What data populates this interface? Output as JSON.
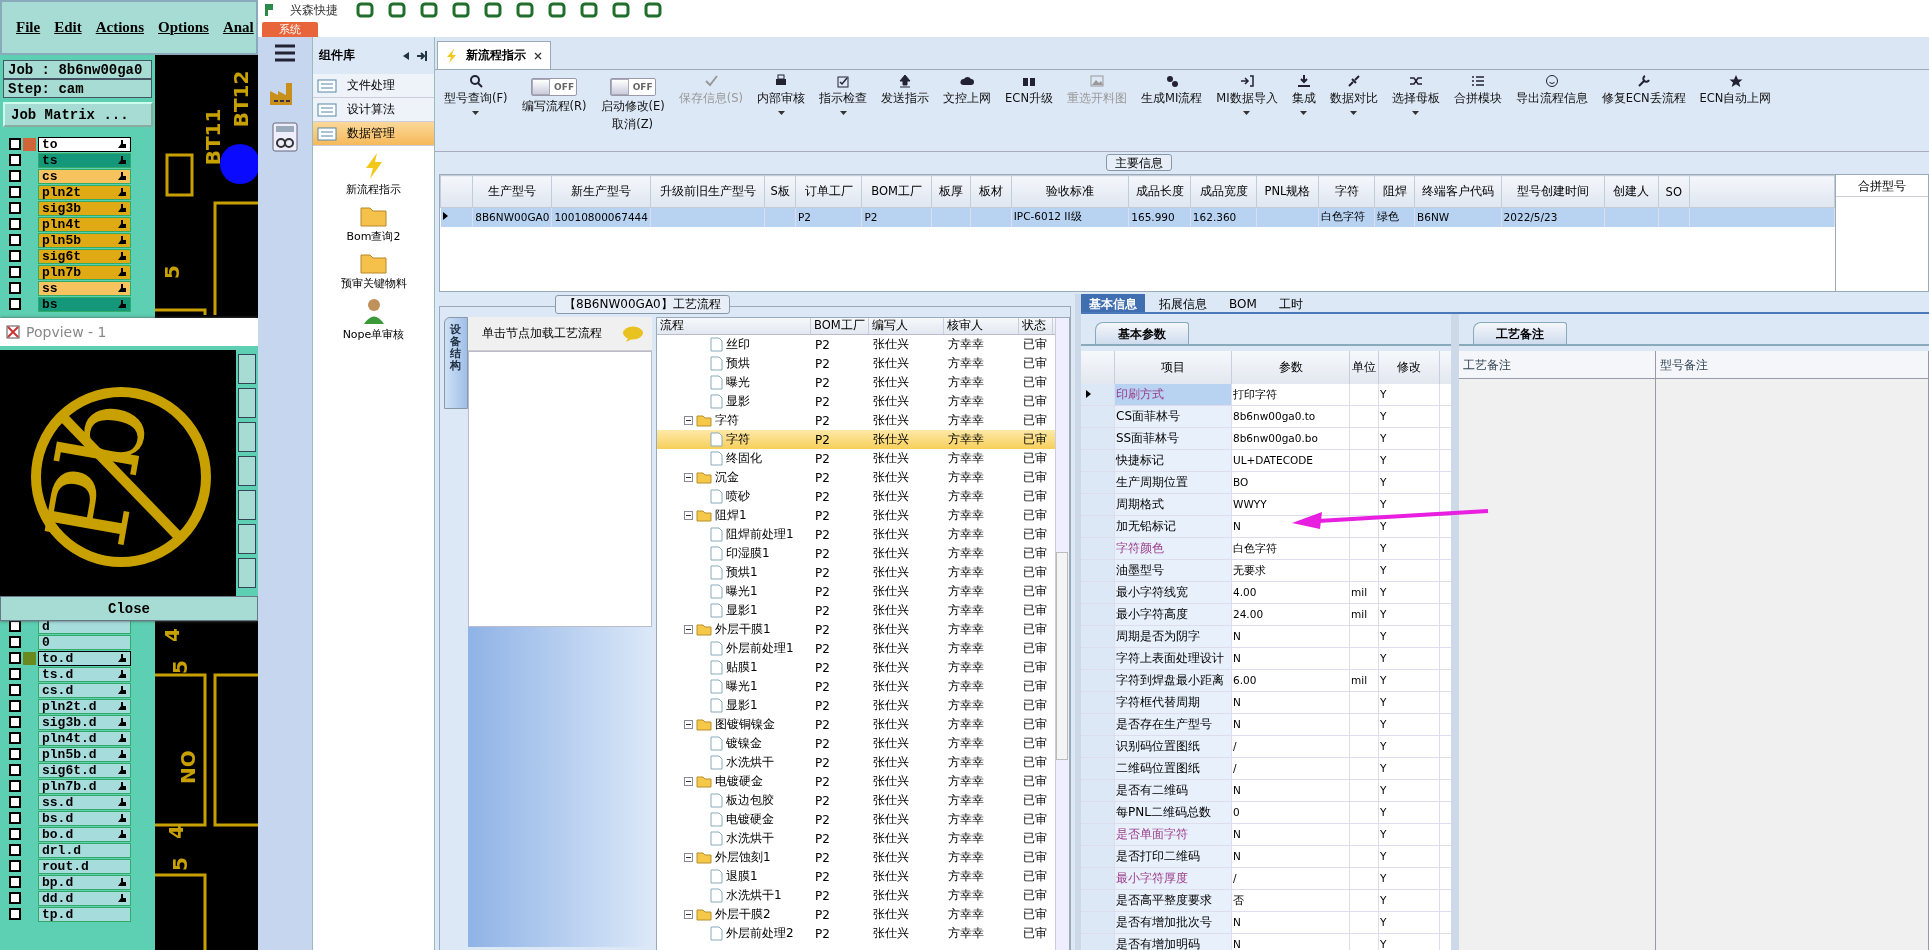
{
  "cam": {
    "menu": [
      "File",
      "Edit",
      "Actions",
      "Options",
      "Anal"
    ],
    "job": "Job : 8b6nw00ga0",
    "step": "Step: cam",
    "matrix_button": "Job Matrix ...",
    "layers_top": [
      {
        "name": "to",
        "color": "#ffffff",
        "selected": true,
        "checked": false,
        "editable": true
      },
      {
        "name": "ts",
        "color": "#15987a",
        "selected": false,
        "checked": false,
        "editable": true
      },
      {
        "name": "cs",
        "color": "#f7c35f",
        "selected": false,
        "checked": false,
        "editable": true
      },
      {
        "name": "pln2t",
        "color": "#e0aa14",
        "selected": false,
        "checked": false,
        "editable": true
      },
      {
        "name": "sig3b",
        "color": "#e0aa14",
        "selected": false,
        "checked": false,
        "editable": true
      },
      {
        "name": "pln4t",
        "color": "#e0aa14",
        "selected": false,
        "checked": false,
        "editable": true
      },
      {
        "name": "pln5b",
        "color": "#e0aa14",
        "selected": false,
        "checked": false,
        "editable": true
      },
      {
        "name": "sig6t",
        "color": "#e0aa14",
        "selected": false,
        "checked": false,
        "editable": true
      },
      {
        "name": "pln7b",
        "color": "#e0aa14",
        "selected": false,
        "checked": false,
        "editable": true
      },
      {
        "name": "ss",
        "color": "#f7c35f",
        "selected": false,
        "checked": false,
        "editable": true
      },
      {
        "name": "bs",
        "color": "#15987a",
        "selected": false,
        "checked": false,
        "editable": true
      }
    ],
    "canvas_labels": [
      "BT11",
      "BT12",
      "5",
      "4",
      "5",
      "NO",
      "4",
      "5"
    ],
    "layers_bottom": [
      {
        "name": "d",
        "color": "#a6dcdc",
        "selected": false,
        "checked": false,
        "editable": false
      },
      {
        "name": "0",
        "color": "#a6dcdc",
        "selected": false,
        "checked": false,
        "editable": false
      },
      {
        "name": "to.d",
        "color": "#a6dcdc",
        "selected": true,
        "checked": false,
        "editable": true
      },
      {
        "name": "ts.d",
        "color": "#a6dcdc",
        "selected": false,
        "checked": false,
        "editable": true
      },
      {
        "name": "cs.d",
        "color": "#a6dcdc",
        "selected": false,
        "checked": false,
        "editable": true
      },
      {
        "name": "pln2t.d",
        "color": "#a6dcdc",
        "selected": false,
        "checked": false,
        "editable": true
      },
      {
        "name": "sig3b.d",
        "color": "#a6dcdc",
        "selected": false,
        "checked": false,
        "editable": true
      },
      {
        "name": "pln4t.d",
        "color": "#a6dcdc",
        "selected": false,
        "checked": false,
        "editable": true
      },
      {
        "name": "pln5b.d",
        "color": "#a6dcdc",
        "selected": false,
        "checked": false,
        "editable": true
      },
      {
        "name": "sig6t.d",
        "color": "#a6dcdc",
        "selected": false,
        "checked": false,
        "editable": true
      },
      {
        "name": "pln7b.d",
        "color": "#a6dcdc",
        "selected": false,
        "checked": false,
        "editable": true
      },
      {
        "name": "ss.d",
        "color": "#a6dcdc",
        "selected": false,
        "checked": false,
        "editable": true
      },
      {
        "name": "bs.d",
        "color": "#a6dcdc",
        "selected": false,
        "checked": false,
        "editable": true
      },
      {
        "name": "bo.d",
        "color": "#a6dcdc",
        "selected": false,
        "checked": false,
        "editable": true
      },
      {
        "name": "drl.d",
        "color": "#a6dcdc",
        "selected": false,
        "checked": false,
        "editable": false
      },
      {
        "name": "rout.d",
        "color": "#a6dcdc",
        "selected": false,
        "checked": false,
        "editable": false
      },
      {
        "name": "bp.d",
        "color": "#a6dcdc",
        "selected": false,
        "checked": false,
        "editable": true
      },
      {
        "name": "dd.d",
        "color": "#a6dcdc",
        "selected": false,
        "checked": false,
        "editable": true
      },
      {
        "name": "tp.d",
        "color": "#a6dcdc",
        "selected": false,
        "checked": false,
        "editable": false
      }
    ]
  },
  "popview": {
    "title": "Popview - 1",
    "symbol_text": "Pb",
    "close_button": "Close"
  },
  "app": {
    "brand": "兴森快捷",
    "system_tab": "系统",
    "library": {
      "title": "组件库",
      "categories": [
        {
          "label": "文件处理",
          "selected": false
        },
        {
          "label": "设计算法",
          "selected": false
        },
        {
          "label": "数据管理",
          "selected": true
        }
      ],
      "tools": [
        {
          "label": "新流程指示"
        },
        {
          "label": "Bom查询2"
        },
        {
          "label": "预审关键物料"
        },
        {
          "label": "Nope单审核"
        }
      ]
    },
    "document_tab": {
      "label": "新流程指示"
    },
    "ribbon": [
      {
        "kind": "button",
        "label": "型号查询(F)",
        "disabled": false,
        "dropdown": true
      },
      {
        "kind": "toggle",
        "label": "编写流程(R)",
        "switch_text": "OFF",
        "on": false
      },
      {
        "kind": "toggle",
        "label": "启动修改(E)",
        "label2": "取消(Z)",
        "switch_text": "OFF",
        "on": false
      },
      {
        "kind": "button",
        "label": "保存信息(S)",
        "disabled": true,
        "dropdown": false
      },
      {
        "kind": "button",
        "label": "内部审核",
        "disabled": false,
        "dropdown": true
      },
      {
        "kind": "button",
        "label": "指示检查",
        "disabled": false,
        "dropdown": true
      },
      {
        "kind": "button",
        "label": "发送指示",
        "disabled": false,
        "dropdown": false
      },
      {
        "kind": "button",
        "label": "文控上网",
        "disabled": false,
        "dropdown": false
      },
      {
        "kind": "button",
        "label": "ECN升级",
        "disabled": false,
        "dropdown": false
      },
      {
        "kind": "button",
        "label": "重选开料图",
        "disabled": true,
        "dropdown": false
      },
      {
        "kind": "button",
        "label": "生成MI流程",
        "disabled": false,
        "dropdown": false
      },
      {
        "kind": "button",
        "label": "MI数据导入",
        "disabled": false,
        "dropdown": true
      },
      {
        "kind": "button",
        "label": "集成",
        "disabled": false,
        "dropdown": true
      },
      {
        "kind": "button",
        "label": "数据对比",
        "disabled": false,
        "dropdown": true
      },
      {
        "kind": "button",
        "label": "选择母板",
        "disabled": false,
        "dropdown": true
      },
      {
        "kind": "button",
        "label": "合拼模块",
        "disabled": false,
        "dropdown": false
      },
      {
        "kind": "button",
        "label": "导出流程信息",
        "disabled": false,
        "dropdown": false
      },
      {
        "kind": "button",
        "label": "修复ECN丢流程",
        "disabled": false,
        "dropdown": false
      },
      {
        "kind": "button",
        "label": "ECN自动上网",
        "disabled": false,
        "dropdown": false
      }
    ],
    "main_info": {
      "title": "主要信息",
      "columns": [
        "生产型号",
        "新生产型号",
        "升级前旧生产型号",
        "S板",
        "订单工厂",
        "BOM工厂",
        "板厚",
        "板材",
        "验收标准",
        "成品长度",
        "成品宽度",
        "PNL规格",
        "字符",
        "阻焊",
        "终端客户代码",
        "型号创建时间",
        "创建人",
        "SO"
      ],
      "rows": [
        {
          "selected": true,
          "cells": [
            "8B6NW00GA0",
            "10010800067444",
            null,
            null,
            "P2",
            "P2",
            null,
            null,
            "IPC-6012 II级",
            "165.990",
            "162.360",
            null,
            "白色字符",
            "绿色",
            "B6NW",
            "2022/5/23",
            null,
            null
          ]
        }
      ],
      "side_column": "合拼型号"
    },
    "flow": {
      "title": "【8B6NW00GA0】工艺流程",
      "side_tab": "设备结构",
      "hint": "单击节点加载工艺流程",
      "columns": [
        "流程",
        "BOM工厂",
        "编写人",
        "核审人",
        "状态"
      ],
      "tree": [
        {
          "children": [
            {
              "label": "丝印",
              "bom": "P2",
              "writer": "张仕兴",
              "reviewer": "方幸幸",
              "status": "已审",
              "selected": false
            },
            {
              "label": "预烘",
              "bom": "P2",
              "writer": "张仕兴",
              "reviewer": "方幸幸",
              "status": "已审",
              "selected": false
            },
            {
              "label": "曝光",
              "bom": "P2",
              "writer": "张仕兴",
              "reviewer": "方幸幸",
              "status": "已审",
              "selected": false
            },
            {
              "label": "显影",
              "bom": "P2",
              "writer": "张仕兴",
              "reviewer": "方幸幸",
              "status": "已审",
              "selected": false
            }
          ]
        },
        {
          "label": "字符",
          "bom": "P2",
          "writer": "张仕兴",
          "reviewer": "方幸幸",
          "status": "已审",
          "selected": false,
          "expanded": true,
          "children": [
            {
              "label": "字符",
              "bom": "P2",
              "writer": "张仕兴",
              "reviewer": "方幸幸",
              "status": "已审",
              "selected": true
            },
            {
              "label": "终固化",
              "bom": "P2",
              "writer": "张仕兴",
              "reviewer": "方幸幸",
              "status": "已审",
              "selected": false
            }
          ]
        },
        {
          "label": "沉金",
          "bom": "P2",
          "writer": "张仕兴",
          "reviewer": "方幸幸",
          "status": "已审",
          "selected": false,
          "expanded": true,
          "children": [
            {
              "label": "喷砂",
              "bom": "P2",
              "writer": "张仕兴",
              "reviewer": "方幸幸",
              "status": "已审",
              "selected": false
            }
          ]
        },
        {
          "label": "阻焊1",
          "bom": "P2",
          "writer": "张仕兴",
          "reviewer": "方幸幸",
          "status": "已审",
          "selected": false,
          "expanded": true,
          "children": [
            {
              "label": "阻焊前处理1",
              "bom": "P2",
              "writer": "张仕兴",
              "reviewer": "方幸幸",
              "status": "已审",
              "selected": false
            },
            {
              "label": "印湿膜1",
              "bom": "P2",
              "writer": "张仕兴",
              "reviewer": "方幸幸",
              "status": "已审",
              "selected": false
            },
            {
              "label": "预烘1",
              "bom": "P2",
              "writer": "张仕兴",
              "reviewer": "方幸幸",
              "status": "已审",
              "selected": false
            },
            {
              "label": "曝光1",
              "bom": "P2",
              "writer": "张仕兴",
              "reviewer": "方幸幸",
              "status": "已审",
              "selected": false
            },
            {
              "label": "显影1",
              "bom": "P2",
              "writer": "张仕兴",
              "reviewer": "方幸幸",
              "status": "已审",
              "selected": false
            }
          ]
        },
        {
          "label": "外层干膜1",
          "bom": "P2",
          "writer": "张仕兴",
          "reviewer": "方幸幸",
          "status": "已审",
          "selected": false,
          "expanded": true,
          "children": [
            {
              "label": "外层前处理1",
              "bom": "P2",
              "writer": "张仕兴",
              "reviewer": "方幸幸",
              "status": "已审",
              "selected": false
            },
            {
              "label": "贴膜1",
              "bom": "P2",
              "writer": "张仕兴",
              "reviewer": "方幸幸",
              "status": "已审",
              "selected": false
            },
            {
              "label": "曝光1",
              "bom": "P2",
              "writer": "张仕兴",
              "reviewer": "方幸幸",
              "status": "已审",
              "selected": false
            },
            {
              "label": "显影1",
              "bom": "P2",
              "writer": "张仕兴",
              "reviewer": "方幸幸",
              "status": "已审",
              "selected": false
            }
          ]
        },
        {
          "label": "图镀铜镍金",
          "bom": "P2",
          "writer": "张仕兴",
          "reviewer": "方幸幸",
          "status": "已审",
          "selected": false,
          "expanded": true,
          "children": [
            {
              "label": "镀镍金",
              "bom": "P2",
              "writer": "张仕兴",
              "reviewer": "方幸幸",
              "status": "已审",
              "selected": false
            },
            {
              "label": "水洗烘干",
              "bom": "P2",
              "writer": "张仕兴",
              "reviewer": "方幸幸",
              "status": "已审",
              "selected": false
            }
          ]
        },
        {
          "label": "电镀硬金",
          "bom": "P2",
          "writer": "张仕兴",
          "reviewer": "方幸幸",
          "status": "已审",
          "selected": false,
          "expanded": true,
          "children": [
            {
              "label": "板边包胶",
              "bom": "P2",
              "writer": "张仕兴",
              "reviewer": "方幸幸",
              "status": "已审",
              "selected": false
            },
            {
              "label": "电镀硬金",
              "bom": "P2",
              "writer": "张仕兴",
              "reviewer": "方幸幸",
              "status": "已审",
              "selected": false
            },
            {
              "label": "水洗烘干",
              "bom": "P2",
              "writer": "张仕兴",
              "reviewer": "方幸幸",
              "status": "已审",
              "selected": false
            }
          ]
        },
        {
          "label": "外层蚀刻1",
          "bom": "P2",
          "writer": "张仕兴",
          "reviewer": "方幸幸",
          "status": "已审",
          "selected": false,
          "expanded": true,
          "children": [
            {
              "label": "退膜1",
              "bom": "P2",
              "writer": "张仕兴",
              "reviewer": "方幸幸",
              "status": "已审",
              "selected": false
            },
            {
              "label": "水洗烘干1",
              "bom": "P2",
              "writer": "张仕兴",
              "reviewer": "方幸幸",
              "status": "已审",
              "selected": false
            }
          ]
        },
        {
          "label": "外层干膜2",
          "bom": "P2",
          "writer": "张仕兴",
          "reviewer": "方幸幸",
          "status": "已审",
          "selected": false,
          "expanded": true,
          "children": [
            {
              "label": "外层前处理2",
              "bom": "P2",
              "writer": "张仕兴",
              "reviewer": "方幸幸",
              "status": "已审",
              "selected": false
            }
          ]
        }
      ]
    },
    "details": {
      "tabs": [
        {
          "label": "基本信息",
          "selected": true
        },
        {
          "label": "拓展信息",
          "selected": false
        },
        {
          "label": "BOM",
          "selected": false
        },
        {
          "label": "工时",
          "selected": false
        }
      ],
      "sub_tab": "基本参数",
      "columns": [
        "项目",
        "参数",
        "单位",
        "修改"
      ],
      "params": [
        {
          "item": "印刷方式",
          "value": "打印字符",
          "modify": "Y",
          "flagged": true,
          "selected": true
        },
        {
          "item": "CS面菲林号",
          "value": "8b6nw00ga0.to",
          "modify": "Y",
          "flagged": false,
          "selected": false
        },
        {
          "item": "SS面菲林号",
          "value": "8b6nw00ga0.bo",
          "modify": "Y",
          "flagged": false,
          "selected": false
        },
        {
          "item": "快捷标记",
          "value": "UL+DATECODE",
          "modify": "Y",
          "flagged": false,
          "selected": false
        },
        {
          "item": "生产周期位置",
          "value": "BO",
          "modify": "Y",
          "flagged": false,
          "selected": false
        },
        {
          "item": "周期格式",
          "value": "WWYY",
          "modify": "Y",
          "flagged": false,
          "selected": false
        },
        {
          "item": "加无铅标记",
          "value": "N",
          "modify": "Y",
          "flagged": false,
          "selected": false
        },
        {
          "item": "字符颜色",
          "value": "白色字符",
          "modify": "Y",
          "flagged": true,
          "selected": false
        },
        {
          "item": "油墨型号",
          "value": "无要求",
          "modify": "Y",
          "flagged": false,
          "selected": false
        },
        {
          "item": "最小字符线宽",
          "value": "4.00",
          "unit": "mil",
          "modify": "Y",
          "flagged": false,
          "selected": false
        },
        {
          "item": "最小字符高度",
          "value": "24.00",
          "unit": "mil",
          "modify": "Y",
          "flagged": false,
          "selected": false
        },
        {
          "item": "周期是否为阴字",
          "value": "N",
          "modify": "Y",
          "flagged": false,
          "selected": false
        },
        {
          "item": "字符上表面处理设计",
          "value": "N",
          "modify": "Y",
          "flagged": false,
          "selected": false
        },
        {
          "item": "字符到焊盘最小距离",
          "value": "6.00",
          "unit": "mil",
          "modify": "Y",
          "flagged": false,
          "selected": false
        },
        {
          "item": "字符框代替周期",
          "value": "N",
          "modify": "Y",
          "flagged": false,
          "selected": false
        },
        {
          "item": "是否存在生产型号",
          "value": "N",
          "modify": "Y",
          "flagged": false,
          "selected": false
        },
        {
          "item": "识别码位置图纸",
          "value": "/",
          "modify": "Y",
          "flagged": false,
          "selected": false
        },
        {
          "item": "二维码位置图纸",
          "value": "/",
          "modify": "Y",
          "flagged": false,
          "selected": false
        },
        {
          "item": "是否有二维码",
          "value": "N",
          "modify": "Y",
          "flagged": false,
          "selected": false
        },
        {
          "item": "每PNL二维码总数",
          "value": "0",
          "modify": "Y",
          "flagged": false,
          "selected": false
        },
        {
          "item": "是否单面字符",
          "value": "N",
          "modify": "Y",
          "flagged": true,
          "selected": false
        },
        {
          "item": "是否打印二维码",
          "value": "N",
          "modify": "Y",
          "flagged": false,
          "selected": false
        },
        {
          "item": "最小字符厚度",
          "value": "/",
          "modify": "Y",
          "flagged": true,
          "selected": false
        },
        {
          "item": "是否高平整度要求",
          "value": "否",
          "modify": "Y",
          "flagged": false,
          "selected": false
        },
        {
          "item": "是否有增加批次号",
          "value": "N",
          "modify": "Y",
          "flagged": false,
          "selected": false
        },
        {
          "item": "是否有增加明码",
          "value": "N",
          "modify": "Y",
          "flagged": false,
          "selected": false
        }
      ],
      "notes": {
        "tab": "工艺备注",
        "columns": [
          "工艺备注",
          "型号备注"
        ]
      }
    }
  }
}
